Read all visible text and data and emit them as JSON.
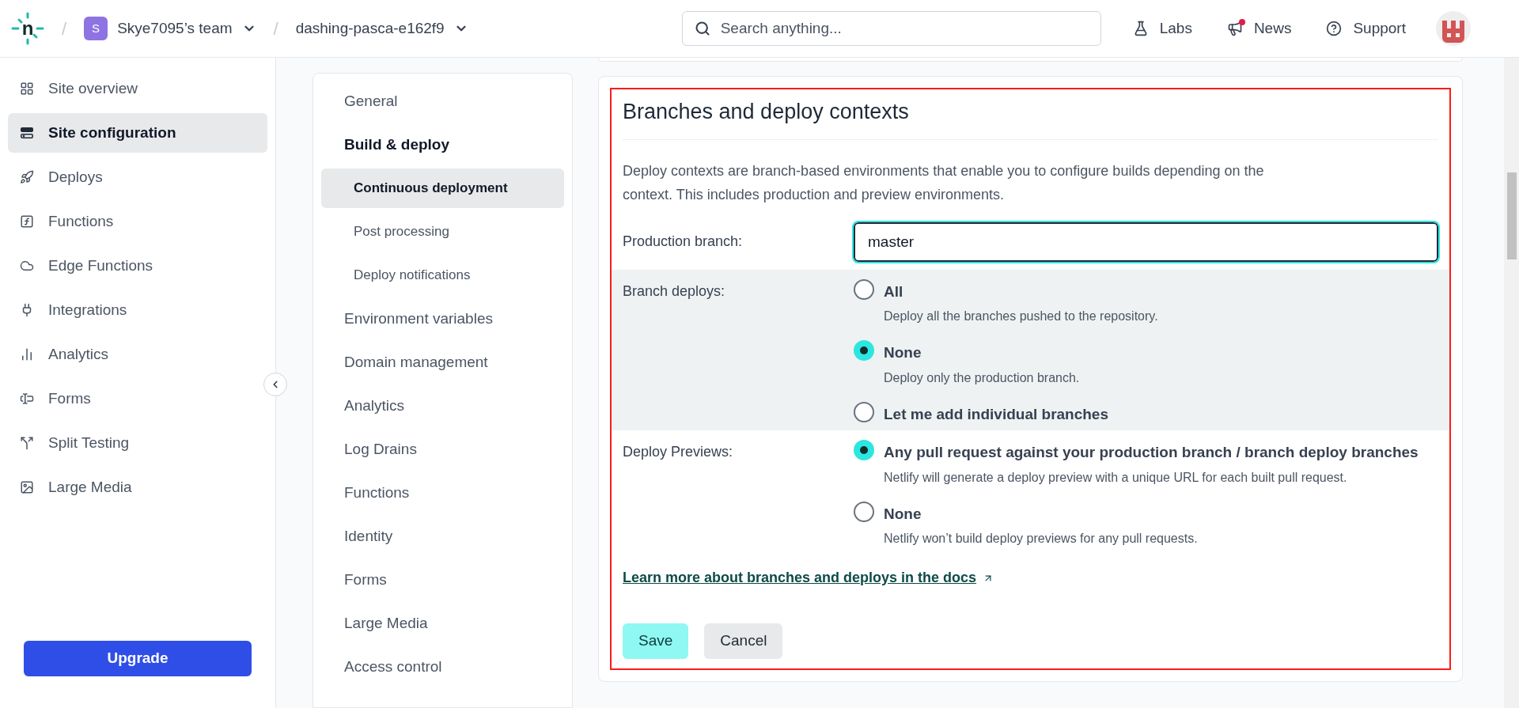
{
  "header": {
    "logo": "n",
    "separators": [
      "/",
      "/"
    ],
    "team": {
      "initial": "S",
      "name": "Skye7095’s team"
    },
    "site": "dashing-pasca-e162f9",
    "search": {
      "placeholder": "Search anything..."
    },
    "links": [
      {
        "label": "Labs",
        "notification": false
      },
      {
        "label": "News",
        "notification": true
      },
      {
        "label": "Support",
        "notification": false
      }
    ]
  },
  "sidebar": {
    "items": [
      {
        "label": "Site overview",
        "selected": false
      },
      {
        "label": "Site configuration",
        "selected": true
      },
      {
        "label": "Deploys",
        "selected": false
      },
      {
        "label": "Functions",
        "selected": false
      },
      {
        "label": "Edge Functions",
        "selected": false
      },
      {
        "label": "Integrations",
        "selected": false
      },
      {
        "label": "Analytics",
        "selected": false
      },
      {
        "label": "Forms",
        "selected": false
      },
      {
        "label": "Split Testing",
        "selected": false
      },
      {
        "label": "Large Media",
        "selected": false
      }
    ],
    "upgrade": "Upgrade"
  },
  "subnav": {
    "items": [
      {
        "label": "General",
        "kind": "item",
        "selected": false
      },
      {
        "label": "Build & deploy",
        "kind": "parent",
        "selected": false
      },
      {
        "label": "Continuous deployment",
        "kind": "sub",
        "selected": true
      },
      {
        "label": "Post processing",
        "kind": "sub",
        "selected": false
      },
      {
        "label": "Deploy notifications",
        "kind": "sub",
        "selected": false
      },
      {
        "label": "Environment variables",
        "kind": "item",
        "selected": false
      },
      {
        "label": "Domain management",
        "kind": "item",
        "selected": false
      },
      {
        "label": "Analytics",
        "kind": "item",
        "selected": false
      },
      {
        "label": "Log Drains",
        "kind": "item",
        "selected": false
      },
      {
        "label": "Functions",
        "kind": "item",
        "selected": false
      },
      {
        "label": "Identity",
        "kind": "item",
        "selected": false
      },
      {
        "label": "Forms",
        "kind": "item",
        "selected": false
      },
      {
        "label": "Large Media",
        "kind": "item",
        "selected": false
      },
      {
        "label": "Access control",
        "kind": "item",
        "selected": false
      }
    ]
  },
  "section": {
    "title": "Branches and deploy contexts",
    "description": "Deploy contexts are branch-based environments that enable you to configure builds depending on the context. This includes production and preview environments.",
    "production_branch": {
      "label": "Production branch:",
      "value": "master"
    },
    "groups": [
      {
        "label": "Branch deploys:",
        "shaded": true,
        "options": [
          {
            "label": "All",
            "description": "Deploy all the branches pushed to the repository.",
            "selected": false
          },
          {
            "label": "None",
            "description": "Deploy only the production branch.",
            "selected": true
          },
          {
            "label": "Let me add individual branches",
            "selected": false
          }
        ]
      },
      {
        "label": "Deploy Previews:",
        "shaded": false,
        "options": [
          {
            "label": "Any pull request against your production branch / branch deploy branches",
            "description": "Netlify will generate a deploy preview with a unique URL for each built pull request.",
            "selected": true
          },
          {
            "label": "None",
            "description": "Netlify won’t build deploy previews for any pull requests.",
            "selected": false
          }
        ]
      }
    ],
    "link": "Learn more about branches and deploys in the docs",
    "buttons": {
      "save": "Save",
      "cancel": "Cancel"
    }
  }
}
